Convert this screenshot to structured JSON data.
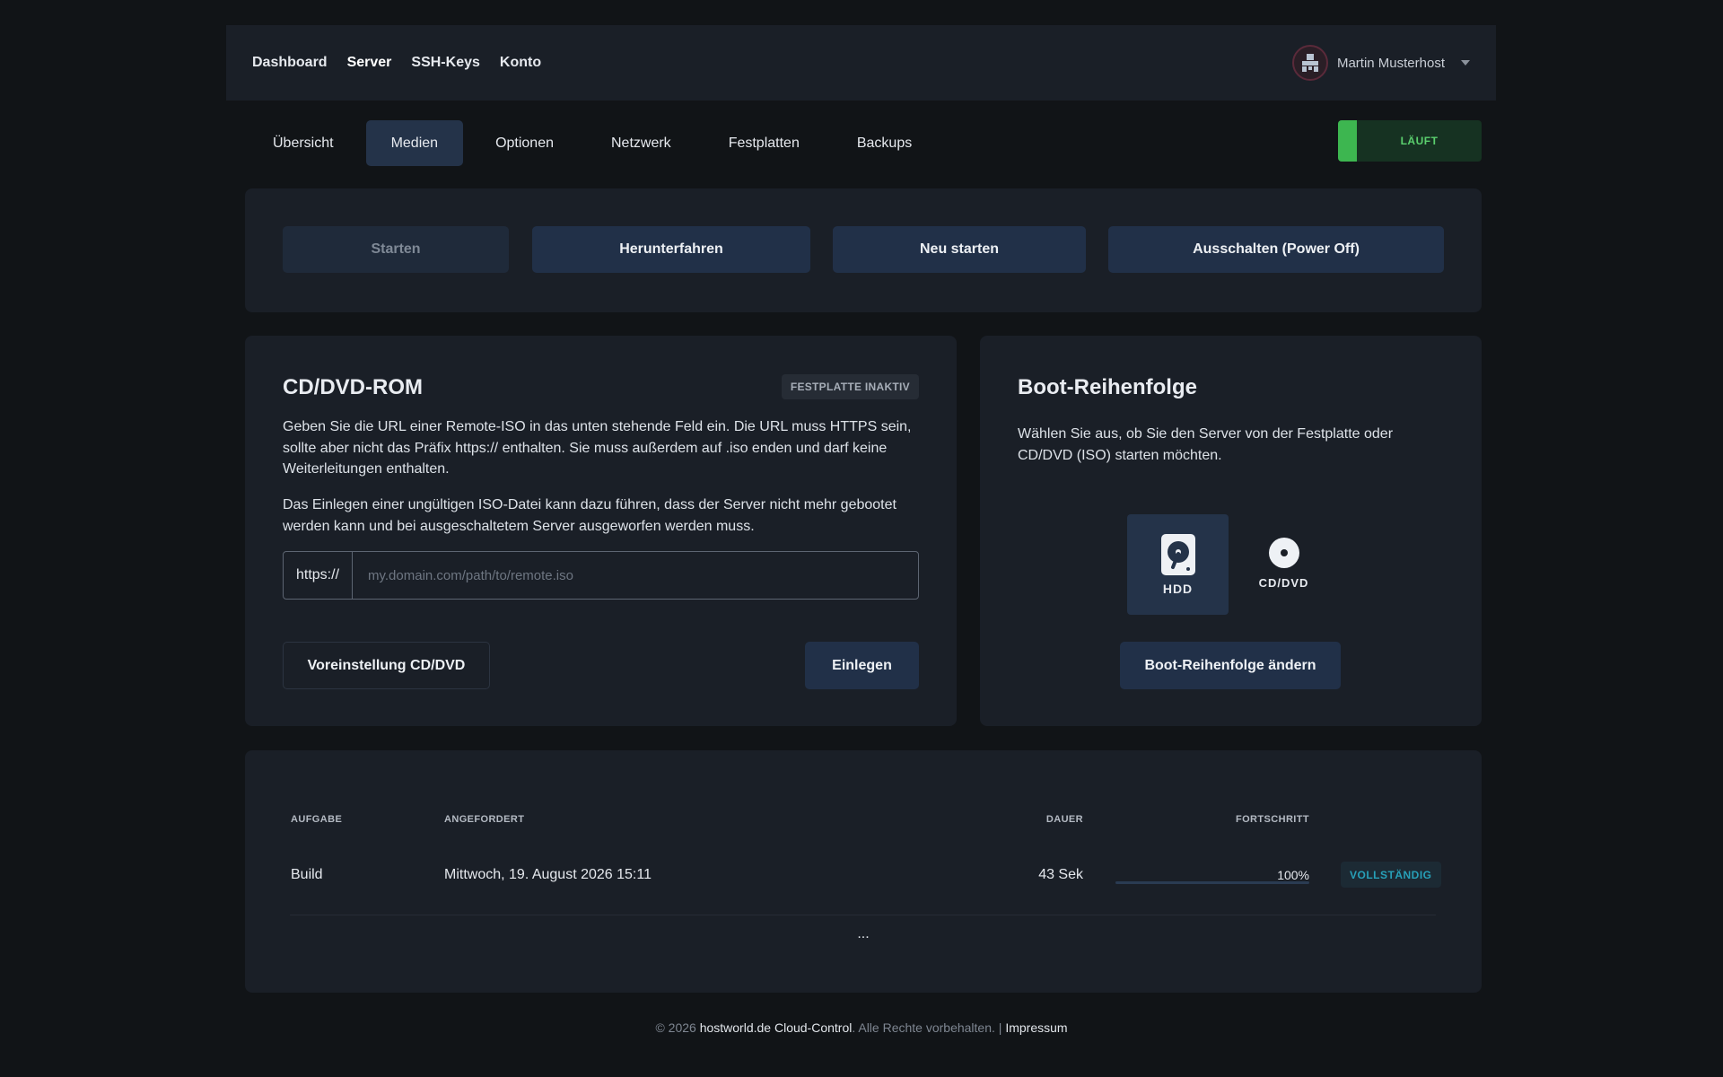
{
  "topnav": {
    "items": [
      {
        "label": "Dashboard"
      },
      {
        "label": "Server"
      },
      {
        "label": "SSH-Keys"
      },
      {
        "label": "Konto"
      }
    ],
    "active": "Server"
  },
  "user": {
    "name": "Martin Musterhost"
  },
  "tabs": [
    {
      "label": "Übersicht"
    },
    {
      "label": "Medien"
    },
    {
      "label": "Optionen"
    },
    {
      "label": "Netzwerk"
    },
    {
      "label": "Festplatten"
    },
    {
      "label": "Backups"
    }
  ],
  "status": {
    "label": "LÄUFT",
    "color": "#3db650"
  },
  "actions": {
    "start": "Starten",
    "shutdown": "Herunterfahren",
    "restart": "Neu starten",
    "poweroff": "Ausschalten (Power Off)"
  },
  "cdrom": {
    "title": "CD/DVD-ROM",
    "badge": "FESTPLATTE INAKTIV",
    "text1": "Geben Sie die URL einer Remote-ISO in das unten stehende Feld ein. Die URL muss HTTPS sein, sollte aber nicht das Präfix https:// enthalten. Sie muss außerdem auf .iso enden und darf keine Weiterleitungen enthalten.",
    "text2": "Das Einlegen einer ungültigen ISO-Datei kann dazu führen, dass der Server nicht mehr gebootet werden kann und bei ausgeschaltetem Server ausgeworfen werden muss.",
    "prefix": "https://",
    "placeholder": "my.domain.com/path/to/remote.iso",
    "preset_button": "Voreinstellung CD/DVD",
    "insert_button": "Einlegen"
  },
  "boot": {
    "title": "Boot-Reihenfolge",
    "text": "Wählen Sie aus, ob Sie den Server von der Festplatte oder CD/DVD (ISO) starten möchten.",
    "option_hdd": "HDD",
    "option_cd": "CD/DVD",
    "selected": "HDD",
    "change_button": "Boot-Reihenfolge ändern"
  },
  "tasks": {
    "headers": {
      "task": "AUFGABE",
      "requested": "ANGEFORDERT",
      "duration": "DAUER",
      "progress": "FORTSCHRITT"
    },
    "rows": [
      {
        "task": "Build",
        "requested": "Mittwoch, 19. August 2026 15:11",
        "duration": "43 Sek",
        "progress_label": "100%",
        "progress_value": 1.0,
        "status": "VOLLSTÄNDIG"
      }
    ],
    "more": "..."
  },
  "footer": {
    "copyright": "© 2026",
    "brand": "hostworld.de Cloud-Control",
    "rights": ". Alle Rechte vorbehalten. |",
    "impressum": "Impressum"
  }
}
